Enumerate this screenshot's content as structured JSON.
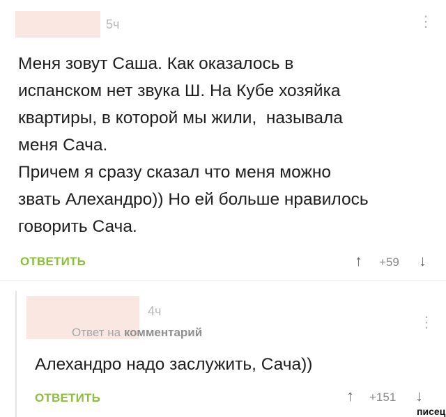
{
  "comment": {
    "time": "5ч",
    "text_lines": [
      "Меня зовут Саша. Как оказалось в",
      "испанском нет звука Ш. На Кубе хозяйка",
      "квартиры, в которой мы жили,  называла",
      "меня Сача.",
      "Причем я сразу сказал что меня можно",
      "звать Алехандро)) Но ей больше нравилось",
      "говорить Сача."
    ],
    "reply_label": "ОТВЕТИТЬ",
    "score": "+59",
    "menu_icon": "⋮",
    "upvote_icon": "↑",
    "downvote_icon": "↓"
  },
  "reply": {
    "time": "4ч",
    "reply_prefix": "Ответ на",
    "reply_target": "комментарий",
    "text": "Алехандро надо заслужить, Сача))",
    "reply_label": "ОТВЕТИТЬ",
    "score": "+151",
    "menu_icon": "⋮",
    "upvote_icon": "↑",
    "downvote_icon": "↓"
  },
  "watermark": "писец",
  "colors": {
    "accent": "#8bbf3b",
    "redacted": "#fbe7e2"
  }
}
